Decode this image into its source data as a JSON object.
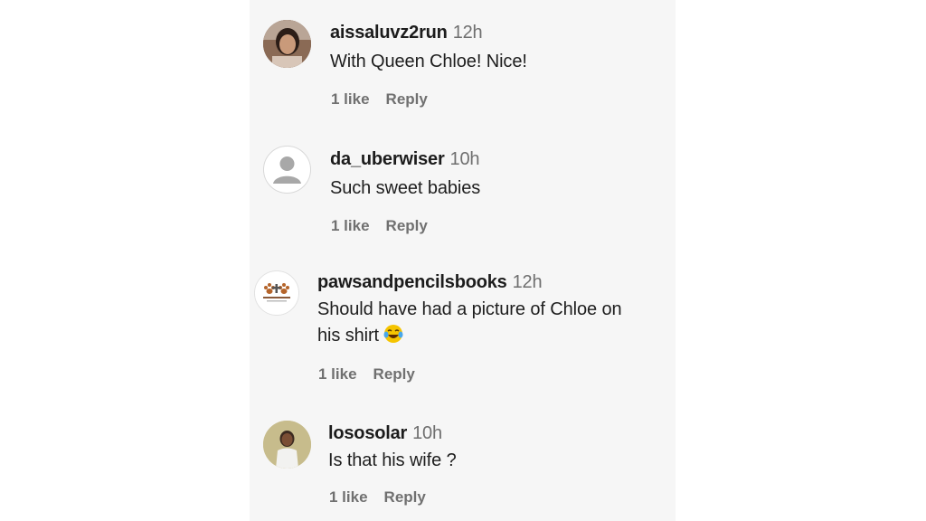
{
  "colors": {
    "strip_bg": "#f6f6f6",
    "username": "#1c1c1c",
    "meta": "#6f6f6f",
    "emoji_face": "#f5c400",
    "emoji_tears": "#49a7ea"
  },
  "comments": [
    {
      "username": "aissaluvz2run",
      "time": "12h",
      "text": "With Queen Chloe! Nice!",
      "likes": "1 like",
      "reply": "Reply",
      "avatar": "profile-photo"
    },
    {
      "username": "da_uberwiser",
      "time": "10h",
      "text": "Such sweet babies",
      "likes": "1 like",
      "reply": "Reply",
      "avatar": "default-person-icon"
    },
    {
      "username": "pawsandpencilsbooks",
      "time": "12h",
      "text_line1": "Should have had a picture of Chloe on",
      "text_line2": "his shirt",
      "emoji": "face-with-tears-of-joy",
      "likes": "1 like",
      "reply": "Reply",
      "avatar": "paw-print-logo"
    },
    {
      "username": "lososolar",
      "time": "10h",
      "text": "Is that his wife ?",
      "likes": "1 like",
      "reply": "Reply",
      "avatar": "profile-photo"
    }
  ]
}
